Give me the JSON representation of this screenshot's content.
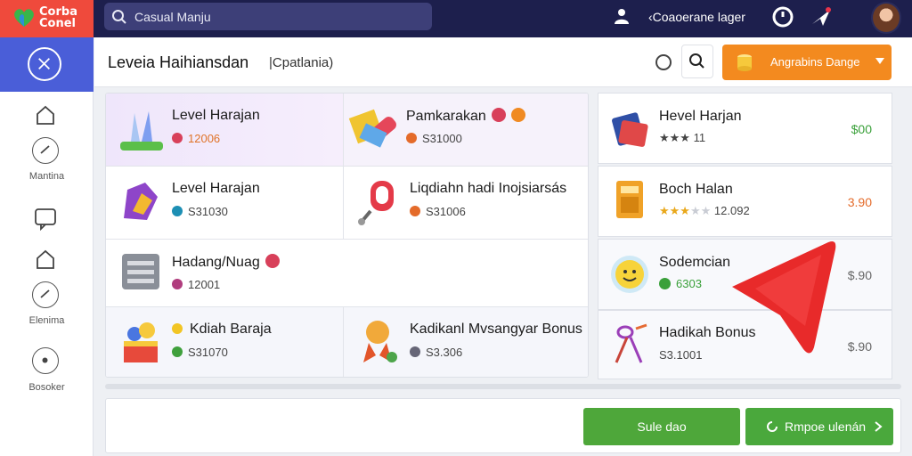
{
  "app": {
    "logo_line1": "Corba",
    "logo_line2": "Conel",
    "search_value": "Casual Manju",
    "user_label": "‹Coaoerane lager"
  },
  "sidebar": {
    "items": [
      {
        "label": "",
        "icon": "edit-icon",
        "active": true
      },
      {
        "label": "",
        "icon": "home-icon"
      },
      {
        "label": "Mantina",
        "icon": "compass-icon"
      },
      {
        "label": "",
        "icon": "chat-icon"
      },
      {
        "label": "",
        "icon": "home-icon"
      },
      {
        "label": "Elenima",
        "icon": "compass-icon"
      },
      {
        "label": "Bosoker",
        "icon": "settings-icon"
      }
    ]
  },
  "header": {
    "title": "Leveia Haihiansdan",
    "subtitle": "|Cpatlania)",
    "upgrade_label": "Angrabins Dange"
  },
  "grid": [
    {
      "name": "Level Harajan",
      "meta": "12006",
      "meta_color": "#e0742a",
      "dot_color": "#d8405a",
      "icon": "rabbit-ears-icon"
    },
    {
      "name": "Pamkarakan",
      "meta": "S31000",
      "dot_color": "#e46b2a",
      "icon": "candy-icon",
      "badges": [
        "#d8405a",
        "#f08a22"
      ]
    },
    {
      "name": "Level Harajan",
      "meta": "S31030",
      "dot_color": "#1d8fb4",
      "icon": "magic-glove-icon"
    },
    {
      "name": "Liqdiahn hadi Inojsiarsás",
      "meta": "S31006",
      "dot_color": "#e46b2a",
      "icon": "key-tag-icon"
    },
    {
      "name": "Hadang/Nuag",
      "meta": "12001",
      "dot_color": "#b03d7e",
      "icon": "server-icon",
      "badges": [
        "#d8405a"
      ]
    },
    {
      "name": "Kdiah Baraja",
      "meta": "S31070",
      "dot_color": "#3fa03c",
      "icon": "gift-basket-icon",
      "name_dot": "#f2c524"
    },
    {
      "name": "Kadikanl Mvsangyar Bonus",
      "meta": "S3.306",
      "dot_color": "#667",
      "icon": "medal-icon"
    }
  ],
  "list": [
    {
      "name": "Hevel Harjan",
      "meta": "★★★ 11",
      "price": "$00",
      "price_color": "#3aa03a",
      "icon": "book-icon"
    },
    {
      "name": "Boch Halan",
      "meta": "12.092",
      "price": "3.90",
      "price_color": "#e46b2a",
      "icon": "calculator-icon",
      "stars": 3
    },
    {
      "name": "Sodemcian",
      "meta": "6303",
      "meta_color": "#3aa03a",
      "price": "$.90",
      "price_color": "#666",
      "icon": "smiley-icon"
    },
    {
      "name": "Hadikah Bonus",
      "meta": "S3.1001",
      "price": "$.90",
      "price_color": "#666",
      "icon": "scissors-icon"
    }
  ],
  "buttons": {
    "primary": "Sule dao",
    "secondary": "Rmpoe ulenán"
  },
  "colors": {
    "topbar": "#1d1f4d",
    "accent": "#4a5ed8",
    "upgrade": "#f38a1f",
    "green": "#4ea73a"
  }
}
